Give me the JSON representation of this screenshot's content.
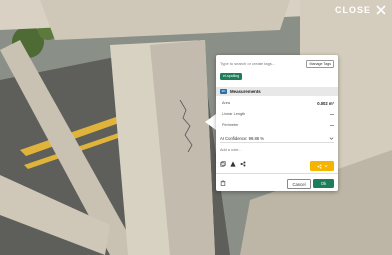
{
  "close": {
    "label": "CLOSE"
  },
  "tags": {
    "placeholder": "Type to search or create tags...",
    "manage_label": "Manage Tags",
    "selected": [
      "el-spalling"
    ]
  },
  "measurements": {
    "title": "Measurements",
    "icon_text": "2D",
    "rows": [
      {
        "label": "Area",
        "value": "0.002 m²"
      },
      {
        "label": "Linear Length",
        "value": "—"
      },
      {
        "label": "Perimeter",
        "value": "—"
      }
    ]
  },
  "ai": {
    "label": "AI Confidence: 99.86 %"
  },
  "note": {
    "placeholder": "Add a note..."
  },
  "actions": {
    "cancel": "Cancel",
    "ok": "Ok"
  },
  "colors": {
    "accent": "#1e7d5b",
    "warning": "#f4b400",
    "info": "#2a6fa8"
  }
}
